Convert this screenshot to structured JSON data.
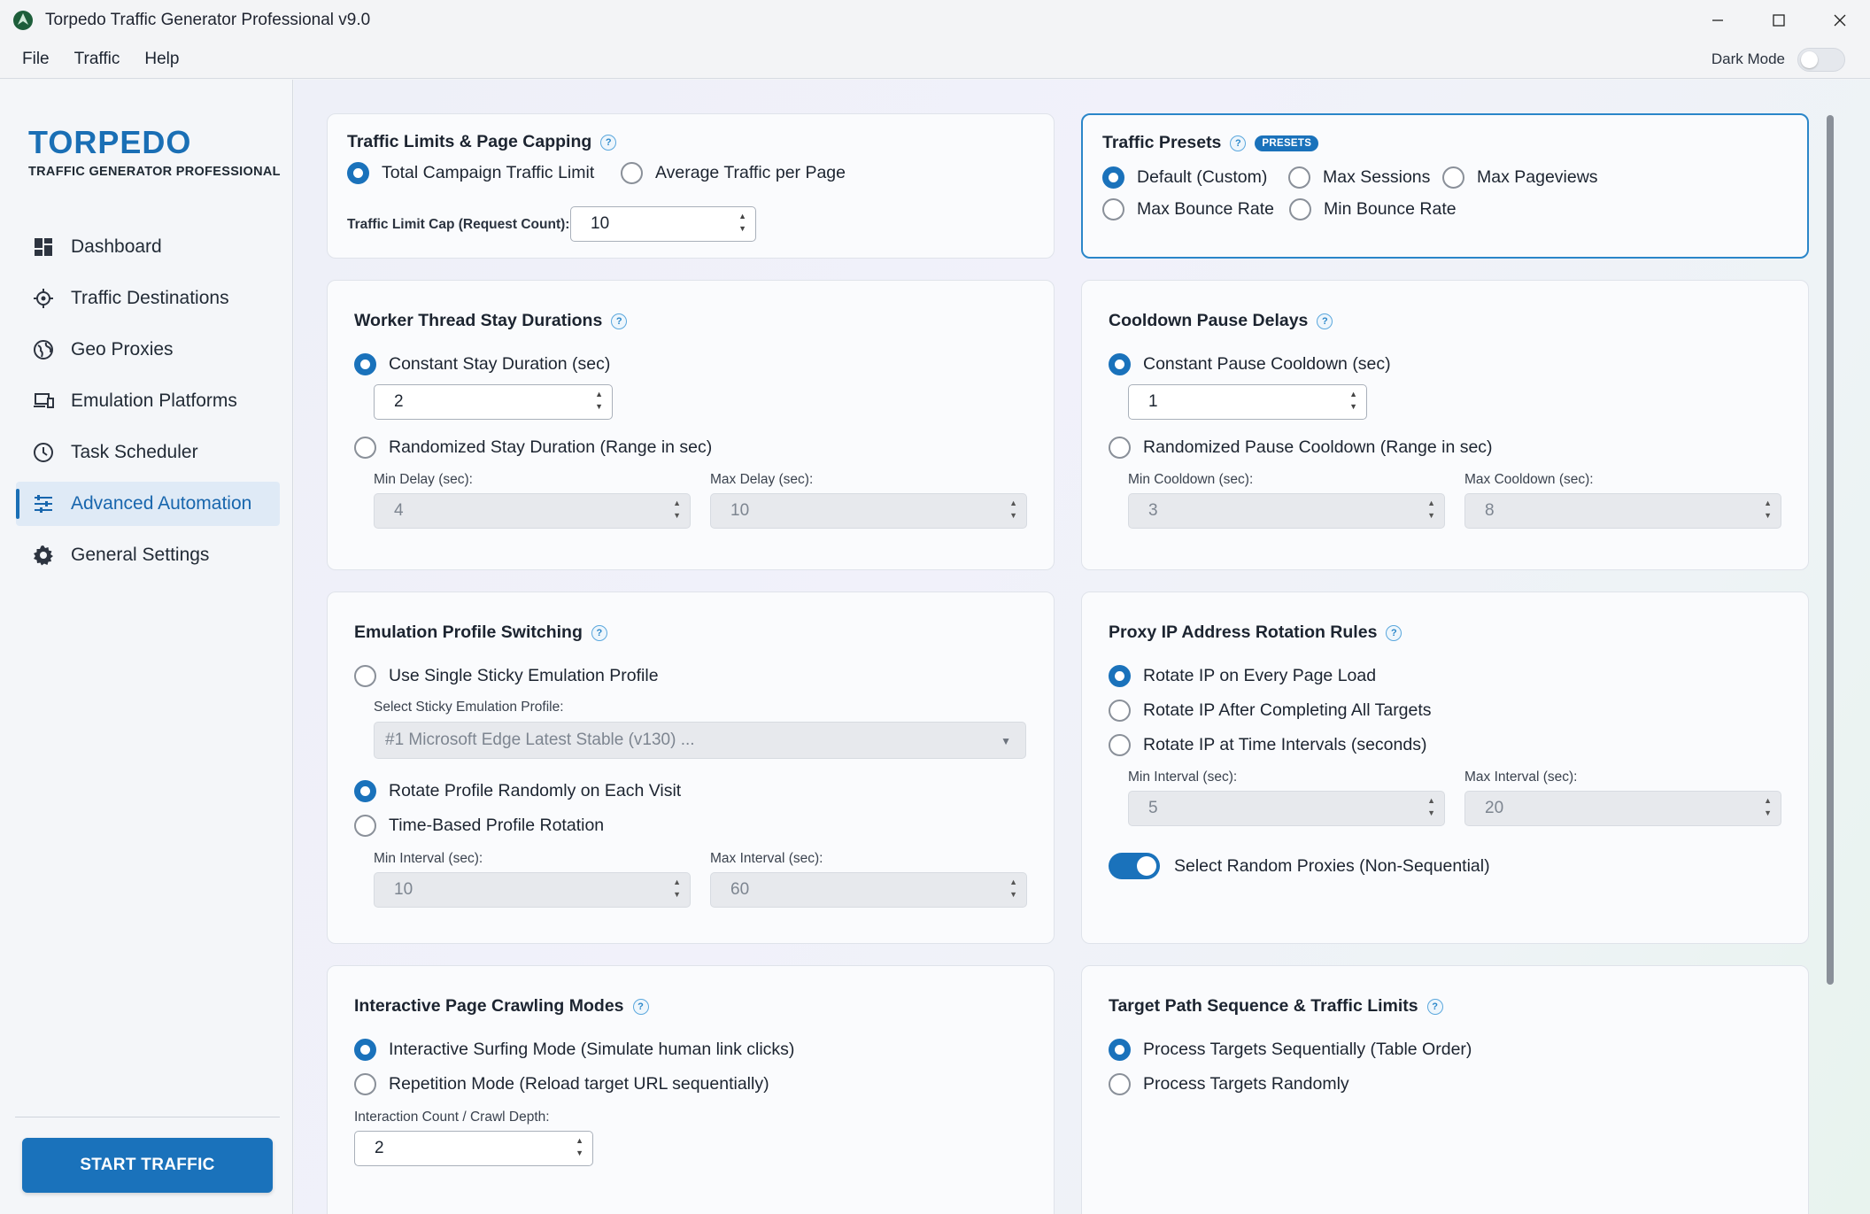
{
  "window": {
    "title": "Torpedo Traffic Generator Professional v9.0"
  },
  "menu": {
    "items": [
      "File",
      "Traffic",
      "Help"
    ],
    "dark_mode_label": "Dark Mode",
    "dark_mode_on": false
  },
  "sidebar": {
    "brand": "TORPEDO",
    "brand_sub": "TRAFFIC GENERATOR PROFESSIONAL",
    "items": [
      {
        "label": "Dashboard",
        "icon": "dashboard-icon"
      },
      {
        "label": "Traffic Destinations",
        "icon": "target-icon"
      },
      {
        "label": "Geo Proxies",
        "icon": "globe-icon"
      },
      {
        "label": "Emulation Platforms",
        "icon": "devices-icon"
      },
      {
        "label": "Task Scheduler",
        "icon": "clock-icon"
      },
      {
        "label": "Advanced Automation",
        "icon": "sliders-icon",
        "active": true
      },
      {
        "label": "General Settings",
        "icon": "gear-icon"
      }
    ],
    "start_button": "START TRAFFIC"
  },
  "traffic_limits": {
    "title": "Traffic Limits & Page Capping",
    "options": [
      "Total Campaign Traffic Limit",
      "Average Traffic per Page"
    ],
    "selected": 0,
    "cap_label": "Traffic Limit Cap (Request Count):",
    "cap_value": "10"
  },
  "traffic_presets": {
    "title": "Traffic Presets",
    "badge": "PRESETS",
    "options": [
      "Default (Custom)",
      "Max Sessions",
      "Max Pageviews",
      "Max Bounce Rate",
      "Min Bounce Rate"
    ],
    "selected": 0
  },
  "stay_durations": {
    "title": "Worker Thread Stay Durations",
    "constant_label": "Constant Stay Duration (sec)",
    "constant_value": "2",
    "random_label": "Randomized Stay Duration (Range in sec)",
    "min_label": "Min Delay (sec):",
    "min_value": "4",
    "max_label": "Max Delay (sec):",
    "max_value": "10"
  },
  "cooldown": {
    "title": "Cooldown Pause Delays",
    "constant_label": "Constant Pause Cooldown (sec)",
    "constant_value": "1",
    "random_label": "Randomized Pause Cooldown (Range in sec)",
    "min_label": "Min Cooldown (sec):",
    "min_value": "3",
    "max_label": "Max Cooldown (sec):",
    "max_value": "8"
  },
  "emulation_switching": {
    "title": "Emulation Profile Switching",
    "sticky_label": "Use Single Sticky Emulation Profile",
    "select_label": "Select Sticky Emulation Profile:",
    "select_value": "#1 Microsoft Edge Latest Stable (v130) ...",
    "random_label": "Rotate Profile Randomly on Each Visit",
    "time_label": "Time-Based Profile Rotation",
    "min_label": "Min Interval (sec):",
    "min_value": "10",
    "max_label": "Max Interval (sec):",
    "max_value": "60"
  },
  "proxy_rotation": {
    "title": "Proxy IP Address Rotation Rules",
    "options": [
      "Rotate IP on Every Page Load",
      "Rotate IP After Completing All Targets",
      "Rotate IP at Time Intervals (seconds)"
    ],
    "selected": 0,
    "min_label": "Min Interval (sec):",
    "min_value": "5",
    "max_label": "Max Interval (sec):",
    "max_value": "20",
    "toggle_label": "Select Random Proxies (Non-Sequential)",
    "toggle_on": true
  },
  "crawling": {
    "title": "Interactive Page Crawling Modes",
    "options": [
      "Interactive Surfing Mode (Simulate human link clicks)",
      "Repetition Mode (Reload target URL sequentially)"
    ],
    "selected": 0,
    "depth_label": "Interaction Count / Crawl Depth:",
    "depth_value": "2"
  },
  "target_sequence": {
    "title": "Target Path Sequence & Traffic Limits",
    "options": [
      "Process Targets Sequentially (Table Order)",
      "Process Targets Randomly"
    ],
    "selected": 0
  },
  "colors": {
    "accent": "#1a72bb",
    "brand": "#1a6fb5",
    "active_nav_bg": "#dfeaf6"
  }
}
